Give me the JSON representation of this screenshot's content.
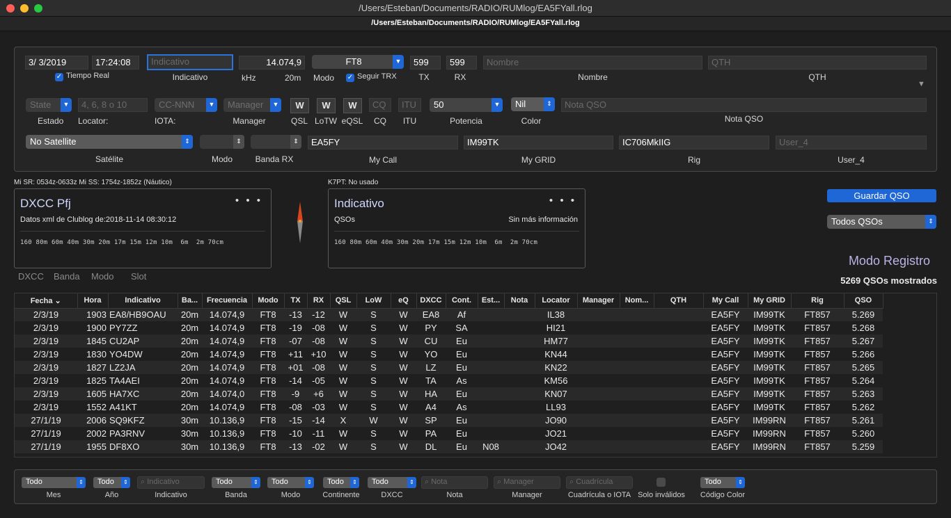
{
  "window": {
    "title": "/Users/Esteban/Documents/RADIO/RUMlog/EA5FYall.rlog",
    "tab_title": "/Users/Esteban/Documents/RADIO/RUMlog/EA5FYall.rlog"
  },
  "entry": {
    "date": "3/  3/2019",
    "time": "17:24:08",
    "tiempo_real_label": "Tiempo Real",
    "callsign_placeholder": "Indicativo",
    "callsign_label": "Indicativo",
    "frequency": "14.074,9",
    "khz_label": "kHz",
    "band": "20m",
    "mode": "FT8",
    "mode_label": "Modo",
    "seguir_trx_label": "Seguir TRX",
    "tx": "599",
    "tx_label": "TX",
    "rx": "599",
    "rx_label": "RX",
    "name_placeholder": "Nombre",
    "name_label": "Nombre",
    "qth_placeholder": "QTH",
    "qth_label": "QTH",
    "state_value": "State",
    "state_label": "Estado",
    "locator_placeholder": "4, 6, 8 o 10",
    "locator_label": "Locator:",
    "iota_value": "CC-NNN",
    "iota_label": "IOTA:",
    "manager_value": "Manager",
    "manager_label": "Manager",
    "qsl_value": "W",
    "qsl_label": "QSL",
    "lotw_value": "W",
    "lotw_label": "LoTW",
    "eqsl_value": "W",
    "eqsl_label": "eQSL",
    "cq_placeholder": "CQ",
    "cq_label": "CQ",
    "itu_placeholder": "ITU",
    "itu_label": "ITU",
    "power": "50",
    "power_label": "Potencia",
    "color_value": "Nil",
    "color_label": "Color",
    "note_placeholder": "Nota QSO",
    "note_label": "Nota QSO",
    "satellite": "No Satellite",
    "satellite_label": "Satélite",
    "sat_mode_label": "Modo",
    "band_rx_label": "Banda RX",
    "my_call": "EA5FY",
    "my_call_label": "My Call",
    "my_grid": "IM99TK",
    "my_grid_label": "My GRID",
    "rig": "IC706MkIIG",
    "rig_label": "Rig",
    "user4_placeholder": "User_4",
    "user4_label": "User_4"
  },
  "sun_info": "Mi SR: 0534z-0633z Mi SS: 1754z-1852z (Náutico)",
  "k7pt_info": "K7PT: No usado",
  "dxcc_card": {
    "title": "DXCC Pfj",
    "info": "Datos xml de Clublog de:2018-11-14 08:30:12",
    "bands": "160 80m 60m 40m 30m 20m 17m 15m 12m 10m  6m  2m 70cm"
  },
  "call_card": {
    "title": "Indicativo",
    "qsos": "QSOs",
    "info": "Sin más información",
    "bands": "160 80m 60m 40m 30m 20m 17m 15m 12m 10m  6m  2m 70cm"
  },
  "view_tabs": [
    "DXCC",
    "Banda",
    "Modo",
    "Slot"
  ],
  "save_button": "Guardar QSO",
  "filter_select": "Todos QSOs",
  "mode_title": "Modo Registro",
  "qso_count": "5269 QSOs mostrados",
  "table": {
    "columns": [
      "Fecha",
      "Hora",
      "Indicativo",
      "Ba...",
      "Frecuencia",
      "Modo",
      "TX",
      "RX",
      "QSL",
      "LoW",
      "eQ",
      "DXCC",
      "Cont.",
      "Est...",
      "Nota",
      "Locator",
      "Manager",
      "Nom...",
      "QTH",
      "My Call",
      "My GRID",
      "Rig",
      "QSO"
    ],
    "rows": [
      [
        "2/3/19",
        "1903",
        "EA8/HB9OAU",
        "20m",
        "14.074,9",
        "FT8",
        "-13",
        "-12",
        "W",
        "S",
        "W",
        "EA8",
        "Af",
        "",
        "",
        "IL38",
        "",
        "",
        "",
        "EA5FY",
        "IM99TK",
        "FT857",
        "5.269"
      ],
      [
        "2/3/19",
        "1900",
        "PY7ZZ",
        "20m",
        "14.074,9",
        "FT8",
        "-19",
        "-08",
        "W",
        "S",
        "W",
        "PY",
        "SA",
        "",
        "",
        "HI21",
        "",
        "",
        "",
        "EA5FY",
        "IM99TK",
        "FT857",
        "5.268"
      ],
      [
        "2/3/19",
        "1845",
        "CU2AP",
        "20m",
        "14.074,9",
        "FT8",
        "-07",
        "-08",
        "W",
        "S",
        "W",
        "CU",
        "Eu",
        "",
        "",
        "HM77",
        "",
        "",
        "",
        "EA5FY",
        "IM99TK",
        "FT857",
        "5.267"
      ],
      [
        "2/3/19",
        "1830",
        "YO4DW",
        "20m",
        "14.074,9",
        "FT8",
        "+11",
        "+10",
        "W",
        "S",
        "W",
        "YO",
        "Eu",
        "",
        "",
        "KN44",
        "",
        "",
        "",
        "EA5FY",
        "IM99TK",
        "FT857",
        "5.266"
      ],
      [
        "2/3/19",
        "1827",
        "LZ2JA",
        "20m",
        "14.074,9",
        "FT8",
        "+01",
        "-08",
        "W",
        "S",
        "W",
        "LZ",
        "Eu",
        "",
        "",
        "KN22",
        "",
        "",
        "",
        "EA5FY",
        "IM99TK",
        "FT857",
        "5.265"
      ],
      [
        "2/3/19",
        "1825",
        "TA4AEI",
        "20m",
        "14.074,9",
        "FT8",
        "-14",
        "-05",
        "W",
        "S",
        "W",
        "TA",
        "As",
        "",
        "",
        "KM56",
        "",
        "",
        "",
        "EA5FY",
        "IM99TK",
        "FT857",
        "5.264"
      ],
      [
        "2/3/19",
        "1605",
        "HA7XC",
        "20m",
        "14.074,0",
        "FT8",
        "-9",
        "+6",
        "W",
        "S",
        "W",
        "HA",
        "Eu",
        "",
        "",
        "KN07",
        "",
        "",
        "",
        "EA5FY",
        "IM99TK",
        "FT857",
        "5.263"
      ],
      [
        "2/3/19",
        "1552",
        "A41KT",
        "20m",
        "14.074,9",
        "FT8",
        "-08",
        "-03",
        "W",
        "S",
        "W",
        "A4",
        "As",
        "",
        "",
        "LL93",
        "",
        "",
        "",
        "EA5FY",
        "IM99TK",
        "FT857",
        "5.262"
      ],
      [
        "27/1/19",
        "2006",
        "SQ9KFZ",
        "30m",
        "10.136,9",
        "FT8",
        "-15",
        "-14",
        "X",
        "W",
        "W",
        "SP",
        "Eu",
        "",
        "",
        "JO90",
        "",
        "",
        "",
        "EA5FY",
        "IM99RN",
        "FT857",
        "5.261"
      ],
      [
        "27/1/19",
        "2002",
        "PA3RNV",
        "30m",
        "10.136,9",
        "FT8",
        "-10",
        "-11",
        "W",
        "S",
        "W",
        "PA",
        "Eu",
        "",
        "",
        "JO21",
        "",
        "",
        "",
        "EA5FY",
        "IM99RN",
        "FT857",
        "5.260"
      ],
      [
        "27/1/19",
        "1955",
        "DF8XO",
        "30m",
        "10.136,9",
        "FT8",
        "-13",
        "-02",
        "W",
        "S",
        "W",
        "DL",
        "Eu",
        "N08",
        "",
        "JO42",
        "",
        "",
        "",
        "EA5FY",
        "IM99RN",
        "FT857",
        "5.259"
      ]
    ]
  },
  "filters": {
    "mes": "Todo",
    "mes_label": "Mes",
    "ano": "Todo",
    "ano_label": "Año",
    "indicativo_placeholder": "Indicativo",
    "indicativo_label": "Indicativo",
    "banda": "Todo",
    "banda_label": "Banda",
    "modo": "Todo",
    "modo_label": "Modo",
    "continente": "Todo",
    "continente_label": "Continente",
    "dxcc": "Todo",
    "dxcc_label": "DXCC",
    "nota_placeholder": "Nota",
    "nota_label": "Nota",
    "manager_placeholder": "Manager",
    "manager_label": "Manager",
    "cuadricula_placeholder": "Cuadrícula",
    "cuadricula_label": "Cuadrícula o IOTA",
    "invalidos_label": "Solo inválidos",
    "color": "Todo",
    "color_label": "Código Color"
  },
  "colors": {
    "accent": "#1f67d6",
    "mode_title": "#b9b3e6",
    "background": "#1e1e1e"
  }
}
